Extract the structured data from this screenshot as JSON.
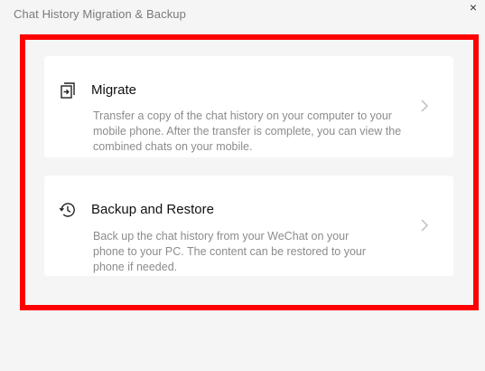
{
  "window": {
    "title": "Chat History Migration & Backup",
    "close_glyph": "×"
  },
  "cards": [
    {
      "icon": "migrate-icon",
      "title": "Migrate",
      "description": "Transfer a copy of the chat history on your computer to your mobile phone. After the transfer is complete, you can view the combined chats on your mobile."
    },
    {
      "icon": "history-clock-icon",
      "title": "Backup and Restore",
      "description": "Back up the chat history from your WeChat on your phone to your PC. The content can be restored to your phone if needed."
    }
  ],
  "colors": {
    "highlight": "#ff0000",
    "background": "#f5f5f5",
    "card": "#ffffff"
  }
}
